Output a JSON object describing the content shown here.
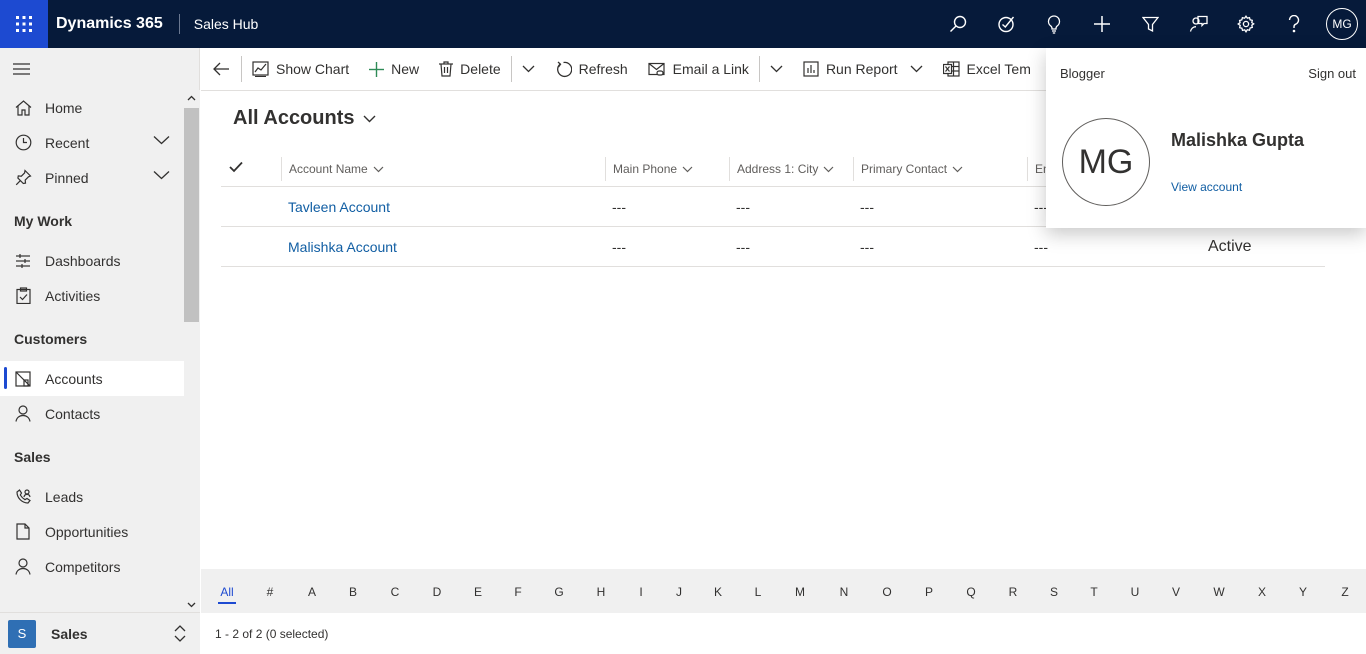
{
  "topbar": {
    "app_title": "Dynamics 365",
    "module": "Sales Hub",
    "avatar_initials": "MG",
    "colors": {
      "bar": "#061a3a",
      "waffle": "#1d4ad1"
    }
  },
  "sidebar": {
    "top_items": [
      {
        "label": "Home",
        "icon": "home-icon"
      },
      {
        "label": "Recent",
        "icon": "clock-icon"
      },
      {
        "label": "Pinned",
        "icon": "pin-icon"
      }
    ],
    "groups": [
      {
        "title": "My Work",
        "items": [
          {
            "label": "Dashboards"
          },
          {
            "label": "Activities"
          }
        ]
      },
      {
        "title": "Customers",
        "items": [
          {
            "label": "Accounts"
          },
          {
            "label": "Contacts"
          }
        ]
      },
      {
        "title": "Sales",
        "items": [
          {
            "label": "Leads"
          },
          {
            "label": "Opportunities"
          },
          {
            "label": "Competitors"
          }
        ]
      }
    ],
    "area": {
      "badge": "S",
      "label": "Sales"
    }
  },
  "commandbar": {
    "show_chart": "Show Chart",
    "new": "New",
    "delete": "Delete",
    "refresh": "Refresh",
    "email_link": "Email a Link",
    "run_report": "Run Report",
    "excel": "Excel Tem"
  },
  "view": {
    "title": "All Accounts",
    "columns": [
      "Account Name",
      "Main Phone",
      "Address 1: City",
      "Primary Contact",
      "En"
    ],
    "rows": [
      {
        "name": "Tavleen Account",
        "phone": "---",
        "city": "---",
        "contact": "---",
        "email": "---",
        "status": ""
      },
      {
        "name": "Malishka Account",
        "phone": "---",
        "city": "---",
        "contact": "---",
        "email": "---",
        "status": "Active"
      }
    ]
  },
  "jumpbar": [
    "All",
    "#",
    "A",
    "B",
    "C",
    "D",
    "E",
    "F",
    "G",
    "H",
    "I",
    "J",
    "K",
    "L",
    "M",
    "N",
    "O",
    "P",
    "Q",
    "R",
    "S",
    "T",
    "U",
    "V",
    "W",
    "X",
    "Y",
    "Z"
  ],
  "status": "1 - 2 of 2 (0 selected)",
  "profile": {
    "org": "Blogger",
    "sign_out": "Sign out",
    "initials": "MG",
    "name": "Malishka Gupta",
    "view_account": "View account"
  }
}
